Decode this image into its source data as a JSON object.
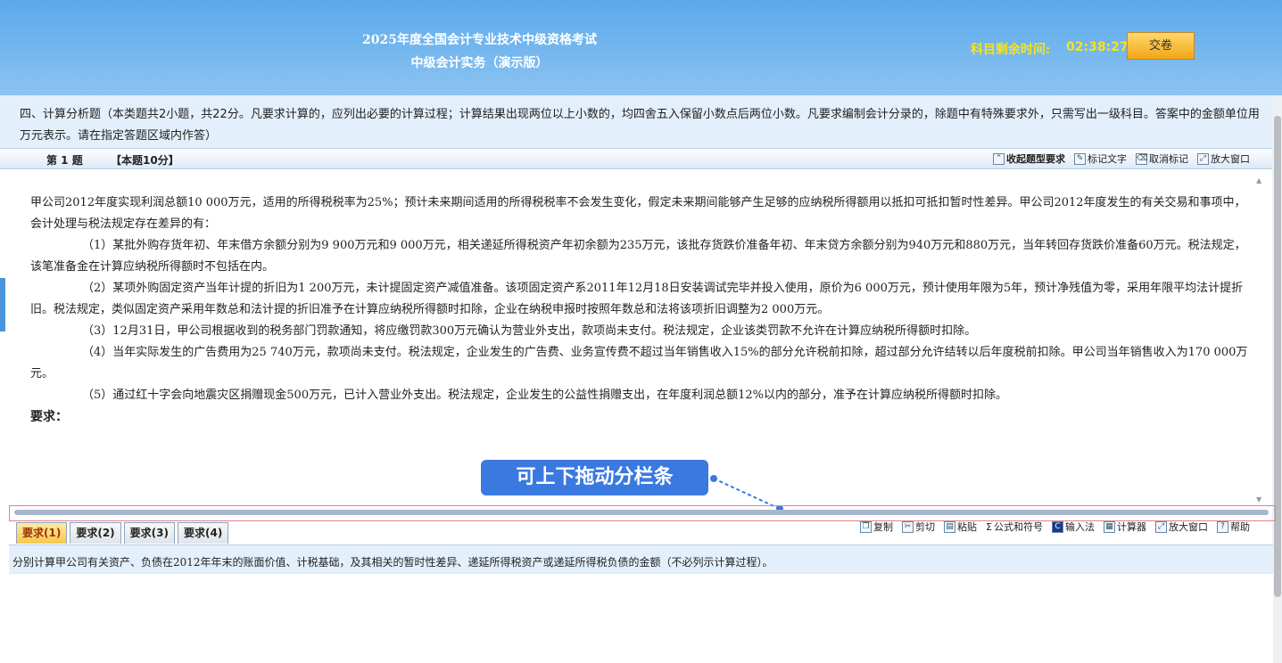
{
  "header": {
    "title_line1": "2025年度全国会计专业技术中级资格考试",
    "title_line2": "中级会计实务（演示版）",
    "timer_label": "科目剩余时间:",
    "timer_value": "02:38:27",
    "submit_label": "交卷"
  },
  "section_intro": "四、计算分析题（本类题共2小题，共22分。凡要求计算的，应列出必要的计算过程；计算结果出现两位以上小数的，均四舍五入保留小数点后两位小数。凡要求编制会计分录的，除题中有特殊要求外，只需写出一级科目。答案中的金额单位用万元表示。请在指定答题区域内作答）",
  "question_bar": {
    "number": "第 1 题",
    "score": "【本题10分】",
    "tools": {
      "collapse": "收起题型要求",
      "mark": "标记文字",
      "unmark": "取消标记",
      "enlarge": "放大窗口"
    }
  },
  "question": {
    "intro": "甲公司2012年度实现利润总额10 000万元，适用的所得税税率为25%；预计未来期间适用的所得税税率不会发生变化，假定未来期间能够产生足够的应纳税所得额用以抵扣可抵扣暂时性差异。甲公司2012年度发生的有关交易和事项中，会计处理与税法规定存在差异的有：",
    "items": [
      "（1）某批外购存货年初、年末借方余额分别为9 900万元和9 000万元，相关递延所得税资产年初余额为235万元，该批存货跌价准备年初、年末贷方余额分别为940万元和880万元，当年转回存货跌价准备60万元。税法规定，该笔准备金在计算应纳税所得额时不包括在内。",
      "（2）某项外购固定资产当年计提的折旧为1 200万元，未计提固定资产减值准备。该项固定资产系2011年12月18日安装调试完毕并投入使用，原价为6 000万元，预计使用年限为5年，预计净残值为零，采用年限平均法计提折旧。税法规定，类似固定资产采用年数总和法计提的折旧准予在计算应纳税所得额时扣除，企业在纳税申报时按照年数总和法将该项折旧调整为2 000万元。",
      "（3）12月31日，甲公司根据收到的税务部门罚款通知，将应缴罚款300万元确认为营业外支出，款项尚未支付。税法规定，企业该类罚款不允许在计算应纳税所得额时扣除。",
      "（4）当年实际发生的广告费用为25 740万元，款项尚未支付。税法规定，企业发生的广告费、业务宣传费不超过当年销售收入15%的部分允许税前扣除，超过部分允许结转以后年度税前扣除。甲公司当年销售收入为170 000万元。",
      "（5）通过红十字会向地震灾区捐赠现金500万元，已计入营业外支出。税法规定，企业发生的公益性捐赠支出，在年度利润总额12%以内的部分，准予在计算应纳税所得额时扣除。"
    ],
    "requirements_heading": "要求："
  },
  "callout_text": "可上下拖动分栏条",
  "answer_tabs": [
    "要求(1)",
    "要求(2)",
    "要求(3)",
    "要求(4)"
  ],
  "answer_tools": {
    "copy": "复制",
    "cut": "剪切",
    "paste": "粘贴",
    "formula": "公式和符号",
    "ime": "输入法",
    "calculator": "计算器",
    "enlarge": "放大窗口",
    "help": "帮助"
  },
  "current_requirement": "分别计算甲公司有关资产、负债在2012年年末的账面价值、计税基础，及其相关的暂时性差异、递延所得税资产或递延所得税负债的金额（不必列示计算过程）。",
  "colors": {
    "header_top": "#5aa9ec",
    "timer": "#f8e21a",
    "submit_button": "#f3a617",
    "callout": "#3a79e0",
    "splitter_highlight": "#e0828b"
  }
}
